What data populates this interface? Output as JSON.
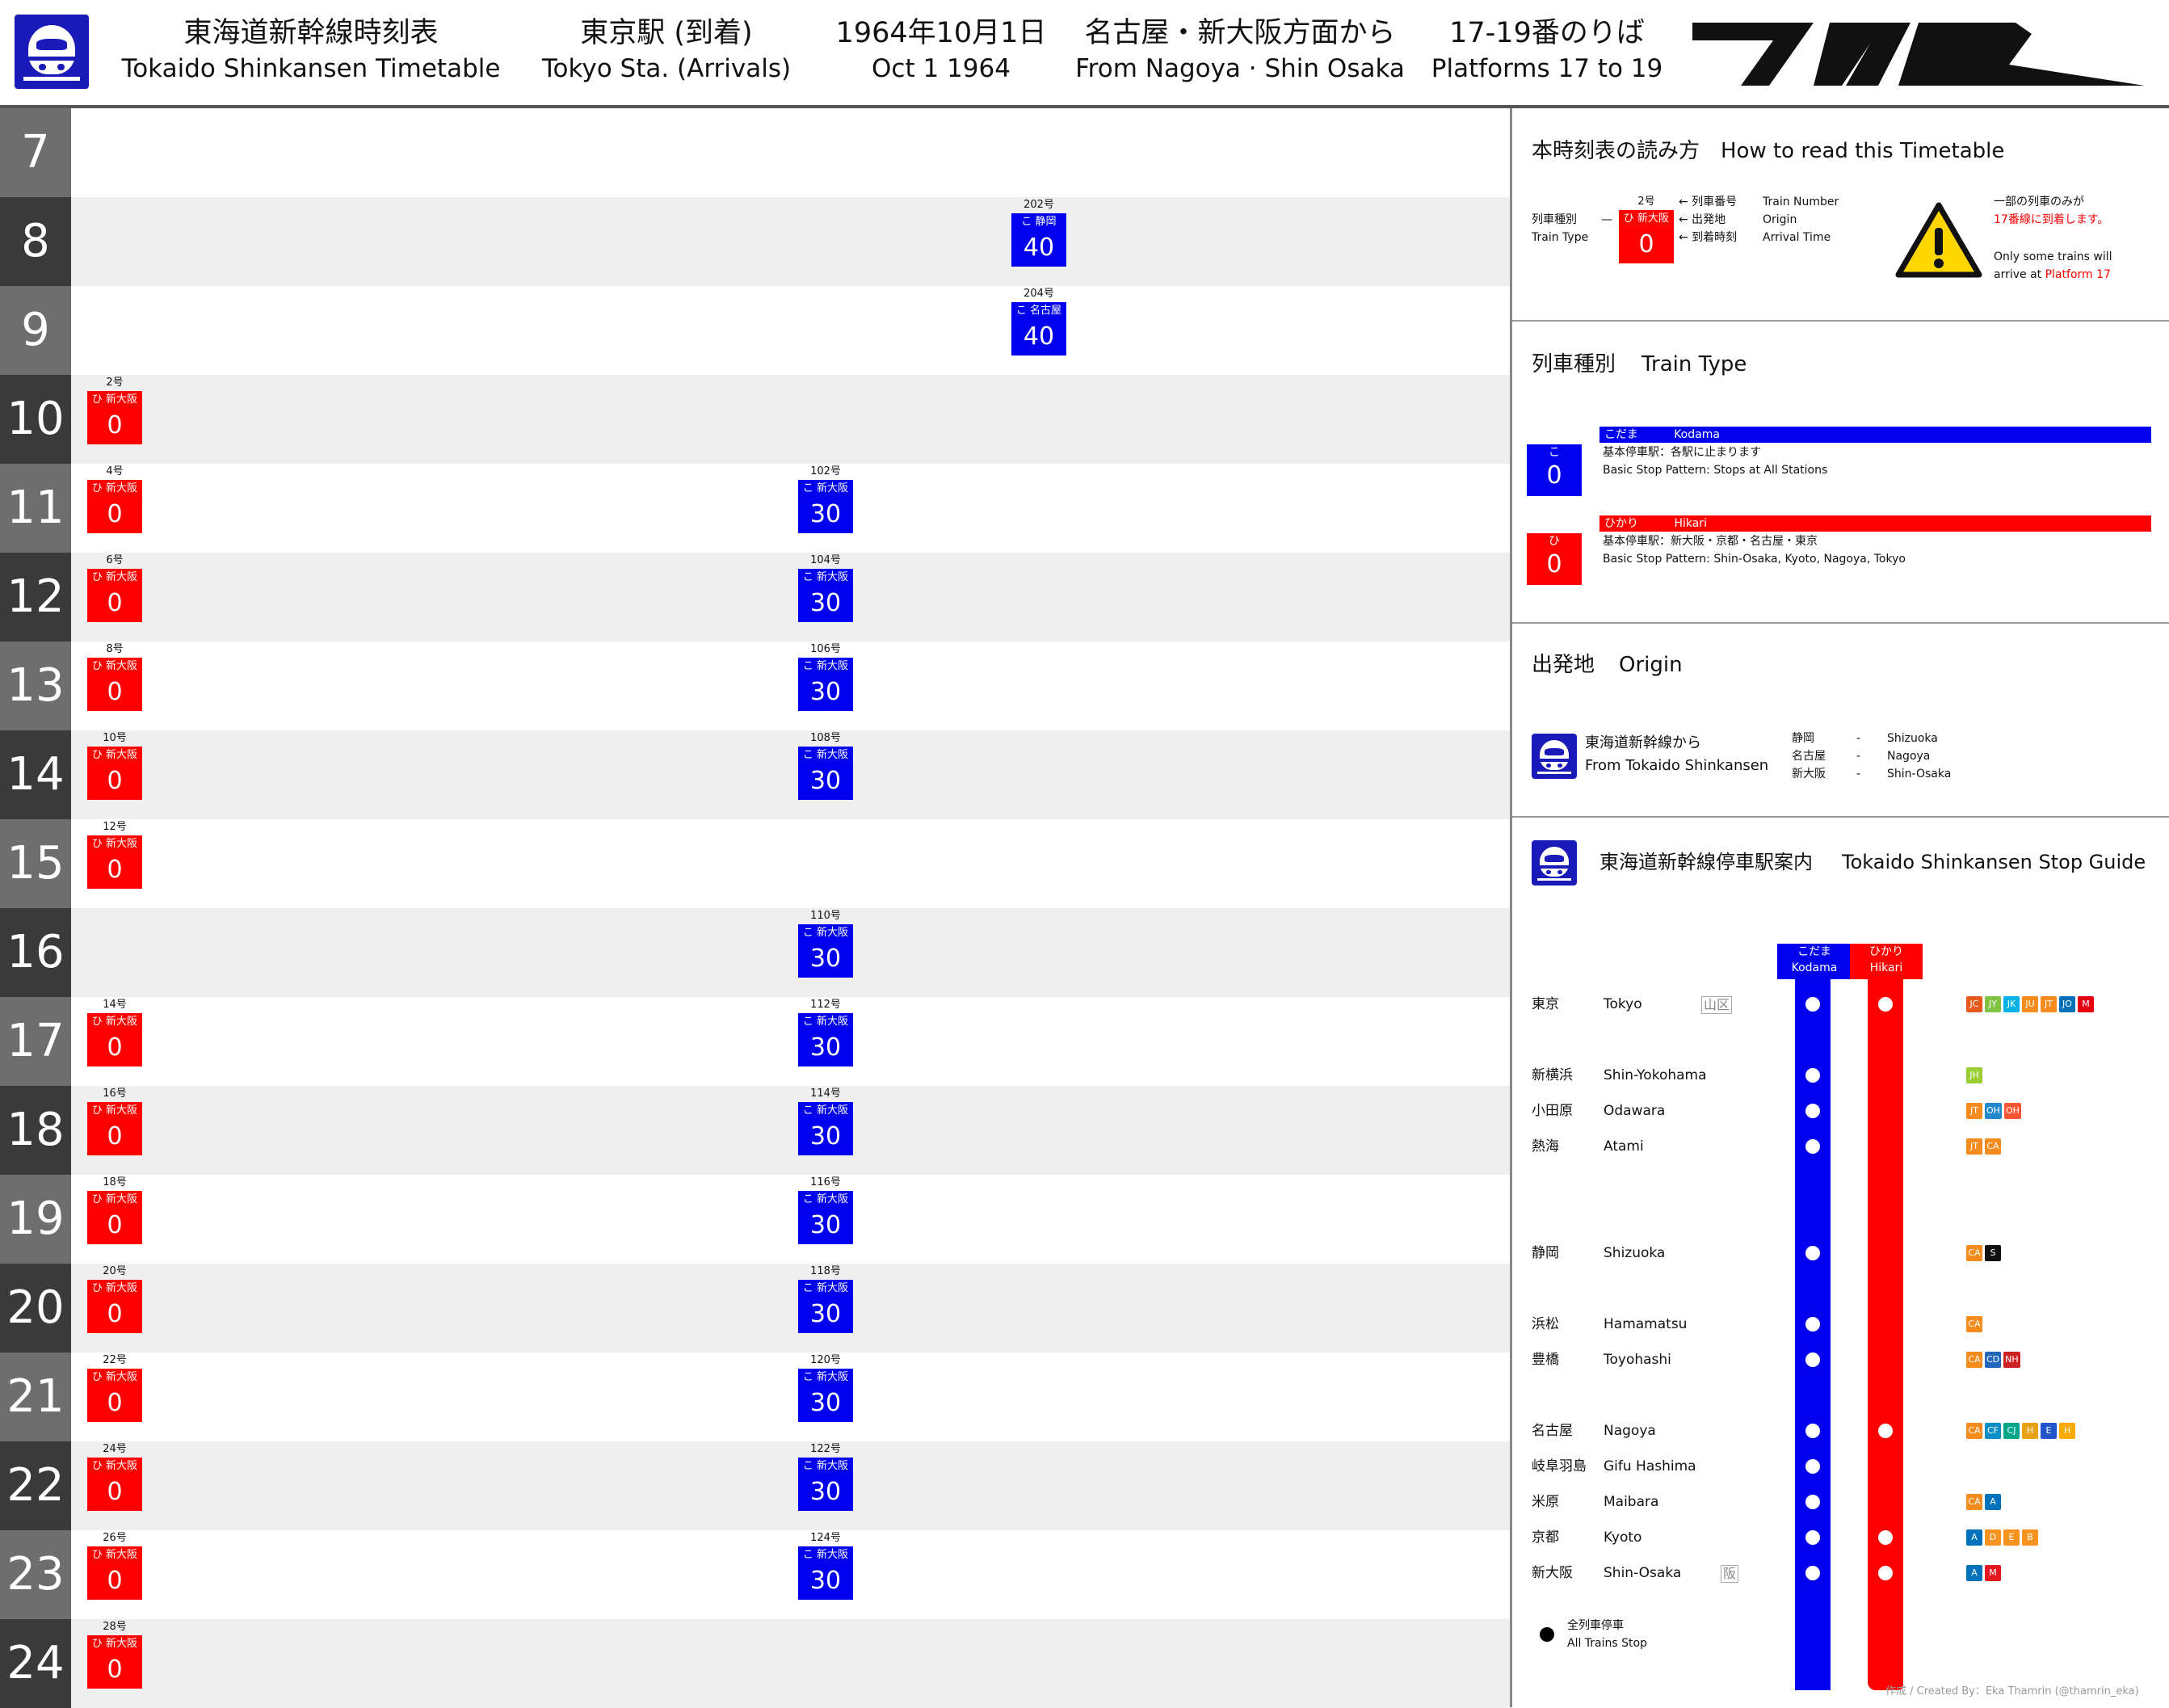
{
  "header": {
    "title_jp": "東海道新幹線時刻表",
    "title_en": "Tokaido Shinkansen Timetable",
    "station_jp": "東京駅 (到着)",
    "station_en": "Tokyo Sta. (Arrivals)",
    "date_jp": "1964年10月1日",
    "date_en": "Oct 1 1964",
    "direction_jp": "名古屋・新大阪方面から",
    "direction_en": "From Nagoya · Shin Osaka",
    "platform_jp": "17-19番のりば",
    "platform_en": "Platforms 17 to 19",
    "brand_logo": "JNR"
  },
  "colors": {
    "hikari": "#ff0000",
    "kodama": "#0000ee",
    "shinkansen_blue": "#1a1ab8"
  },
  "timetable": [
    {
      "hour": "7",
      "trains": []
    },
    {
      "hour": "8",
      "trains": [
        {
          "type": "kodama",
          "number": "202号",
          "tag": "こ 静岡",
          "minute": "40",
          "col": 3
        }
      ]
    },
    {
      "hour": "9",
      "trains": [
        {
          "type": "kodama",
          "number": "204号",
          "tag": "こ 名古屋",
          "minute": "40",
          "col": 3
        }
      ]
    },
    {
      "hour": "10",
      "trains": [
        {
          "type": "hikari",
          "number": "2号",
          "tag": "ひ 新大阪",
          "minute": "0",
          "col": 0
        }
      ]
    },
    {
      "hour": "11",
      "trains": [
        {
          "type": "hikari",
          "number": "4号",
          "tag": "ひ 新大阪",
          "minute": "0",
          "col": 0
        },
        {
          "type": "kodama",
          "number": "102号",
          "tag": "こ 新大阪",
          "minute": "30",
          "col": 2
        }
      ]
    },
    {
      "hour": "12",
      "trains": [
        {
          "type": "hikari",
          "number": "6号",
          "tag": "ひ 新大阪",
          "minute": "0",
          "col": 0
        },
        {
          "type": "kodama",
          "number": "104号",
          "tag": "こ 新大阪",
          "minute": "30",
          "col": 2
        }
      ]
    },
    {
      "hour": "13",
      "trains": [
        {
          "type": "hikari",
          "number": "8号",
          "tag": "ひ 新大阪",
          "minute": "0",
          "col": 0
        },
        {
          "type": "kodama",
          "number": "106号",
          "tag": "こ 新大阪",
          "minute": "30",
          "col": 2
        }
      ]
    },
    {
      "hour": "14",
      "trains": [
        {
          "type": "hikari",
          "number": "10号",
          "tag": "ひ 新大阪",
          "minute": "0",
          "col": 0
        },
        {
          "type": "kodama",
          "number": "108号",
          "tag": "こ 新大阪",
          "minute": "30",
          "col": 2
        }
      ]
    },
    {
      "hour": "15",
      "trains": [
        {
          "type": "hikari",
          "number": "12号",
          "tag": "ひ 新大阪",
          "minute": "0",
          "col": 0
        }
      ]
    },
    {
      "hour": "16",
      "trains": [
        {
          "type": "kodama",
          "number": "110号",
          "tag": "こ 新大阪",
          "minute": "30",
          "col": 2
        }
      ]
    },
    {
      "hour": "17",
      "trains": [
        {
          "type": "hikari",
          "number": "14号",
          "tag": "ひ 新大阪",
          "minute": "0",
          "col": 0
        },
        {
          "type": "kodama",
          "number": "112号",
          "tag": "こ 新大阪",
          "minute": "30",
          "col": 2
        }
      ]
    },
    {
      "hour": "18",
      "trains": [
        {
          "type": "hikari",
          "number": "16号",
          "tag": "ひ 新大阪",
          "minute": "0",
          "col": 0
        },
        {
          "type": "kodama",
          "number": "114号",
          "tag": "こ 新大阪",
          "minute": "30",
          "col": 2
        }
      ]
    },
    {
      "hour": "19",
      "trains": [
        {
          "type": "hikari",
          "number": "18号",
          "tag": "ひ 新大阪",
          "minute": "0",
          "col": 0
        },
        {
          "type": "kodama",
          "number": "116号",
          "tag": "こ 新大阪",
          "minute": "30",
          "col": 2
        }
      ]
    },
    {
      "hour": "20",
      "trains": [
        {
          "type": "hikari",
          "number": "20号",
          "tag": "ひ 新大阪",
          "minute": "0",
          "col": 0
        },
        {
          "type": "kodama",
          "number": "118号",
          "tag": "こ 新大阪",
          "minute": "30",
          "col": 2
        }
      ]
    },
    {
      "hour": "21",
      "trains": [
        {
          "type": "hikari",
          "number": "22号",
          "tag": "ひ 新大阪",
          "minute": "0",
          "col": 0
        },
        {
          "type": "kodama",
          "number": "120号",
          "tag": "こ 新大阪",
          "minute": "30",
          "col": 2
        }
      ]
    },
    {
      "hour": "22",
      "trains": [
        {
          "type": "hikari",
          "number": "24号",
          "tag": "ひ 新大阪",
          "minute": "0",
          "col": 0
        },
        {
          "type": "kodama",
          "number": "122号",
          "tag": "こ 新大阪",
          "minute": "30",
          "col": 2
        }
      ]
    },
    {
      "hour": "23",
      "trains": [
        {
          "type": "hikari",
          "number": "26号",
          "tag": "ひ 新大阪",
          "minute": "0",
          "col": 0
        },
        {
          "type": "kodama",
          "number": "124号",
          "tag": "こ 新大阪",
          "minute": "30",
          "col": 2
        }
      ]
    },
    {
      "hour": "24",
      "trains": [
        {
          "type": "hikari",
          "number": "28号",
          "tag": "ひ 新大阪",
          "minute": "0",
          "col": 0
        }
      ]
    }
  ],
  "howto": {
    "title_jp": "本時刻表の読み方",
    "title_en": "How to read this Timetable",
    "type_jp": "列車種別",
    "type_en": "Train Type",
    "sample_number": "2号",
    "sample_tag": "ひ 新大阪",
    "sample_minute": "0",
    "label_number_jp": "← 列車番号",
    "label_origin_jp": "← 出発地",
    "label_time_jp": "← 到着時刻",
    "label_number_en": "Train Number",
    "label_origin_en": "Origin",
    "label_time_en": "Arrival Time",
    "warning_icon": "warning-triangle-icon",
    "note_jp_1": "一部の列車のみが",
    "note_jp_2": "17番線に到着します。",
    "note_en_1": "Only some trains will",
    "note_en_2": "arrive at ",
    "note_en_platform": "Platform 17"
  },
  "train_types": {
    "title_jp": "列車種別",
    "title_en": "Train Type",
    "kodama": {
      "icon": "こ",
      "minute": "0",
      "name_jp": "こだま",
      "name_en": "Kodama",
      "desc_jp": "基本停車駅：各駅に止まります",
      "desc_en": "Basic Stop Pattern: Stops at All Stations"
    },
    "hikari": {
      "icon": "ひ",
      "minute": "0",
      "name_jp": "ひかり",
      "name_en": "Hikari",
      "desc_jp": "基本停車駅：新大阪・京都・名古屋・東京",
      "desc_en": "Basic Stop Pattern: Shin-Osaka, Kyoto, Nagoya, Tokyo"
    }
  },
  "origin": {
    "title_jp": "出発地",
    "title_en": "Origin",
    "from_jp": "東海道新幹線から",
    "from_en": "From Tokaido Shinkansen",
    "list": [
      {
        "jp": "静岡",
        "dash": "-",
        "en": "Shizuoka"
      },
      {
        "jp": "名古屋",
        "dash": "-",
        "en": "Nagoya"
      },
      {
        "jp": "新大阪",
        "dash": "-",
        "en": "Shin-Osaka"
      }
    ]
  },
  "stop_guide": {
    "title_jp": "東海道新幹線停車駅案内",
    "title_en": "Tokaido Shinkansen Stop Guide",
    "kodama_jp": "こだま",
    "kodama_en": "Kodama",
    "hikari_jp": "ひかり",
    "hikari_en": "Hikari",
    "stations": [
      {
        "jp": "東京",
        "en": "Tokyo",
        "mark": "山区",
        "kodama": true,
        "hikari": true,
        "conn": [
          "JC",
          "JY",
          "JK",
          "JU",
          "JT",
          "JO",
          "M"
        ],
        "conn_colors": [
          "#e65a1e",
          "#80c241",
          "#00b2e5",
          "#f68b1e",
          "#f68b1e",
          "#0070b9",
          "#e60012"
        ]
      },
      {
        "jp": "新横浜",
        "en": "Shin-Yokohama",
        "mark": "",
        "kodama": true,
        "hikari": false,
        "conn": [
          "JH"
        ],
        "conn_colors": [
          "#9acd32"
        ]
      },
      {
        "jp": "小田原",
        "en": "Odawara",
        "mark": "",
        "kodama": true,
        "hikari": false,
        "conn": [
          "JT",
          "OH",
          "OH"
        ],
        "conn_colors": [
          "#f68b1e",
          "#2288cc",
          "#ff5533"
        ]
      },
      {
        "jp": "熱海",
        "en": "Atami",
        "mark": "",
        "kodama": true,
        "hikari": false,
        "conn": [
          "JT",
          "CA"
        ],
        "conn_colors": [
          "#f68b1e",
          "#f68b1e"
        ]
      },
      {
        "jp": "静岡",
        "en": "Shizuoka",
        "mark": "",
        "kodama": true,
        "hikari": false,
        "conn": [
          "CA",
          "S"
        ],
        "conn_colors": [
          "#f68b1e",
          "#111111"
        ]
      },
      {
        "jp": "浜松",
        "en": "Hamamatsu",
        "mark": "",
        "kodama": true,
        "hikari": false,
        "conn": [
          "CA"
        ],
        "conn_colors": [
          "#f68b1e"
        ]
      },
      {
        "jp": "豊橋",
        "en": "Toyohashi",
        "mark": "",
        "kodama": true,
        "hikari": false,
        "conn": [
          "CA",
          "CD",
          "NH"
        ],
        "conn_colors": [
          "#f68b1e",
          "#2266bb",
          "#cc2222"
        ]
      },
      {
        "jp": "名古屋",
        "en": "Nagoya",
        "mark": "",
        "kodama": true,
        "hikari": true,
        "conn": [
          "CA",
          "CF",
          "CJ",
          "H",
          "E",
          "H"
        ],
        "conn_colors": [
          "#f68b1e",
          "#0a8ec6",
          "#00a58a",
          "#e8a215",
          "#2255cc",
          "#ffaa00"
        ]
      },
      {
        "jp": "岐阜羽島",
        "en": "Gifu Hashima",
        "mark": "",
        "kodama": true,
        "hikari": false,
        "conn": [],
        "conn_colors": []
      },
      {
        "jp": "米原",
        "en": "Maibara",
        "mark": "",
        "kodama": true,
        "hikari": false,
        "conn": [
          "CA",
          "A"
        ],
        "conn_colors": [
          "#f68b1e",
          "#0072bc"
        ]
      },
      {
        "jp": "京都",
        "en": "Kyoto",
        "mark": "",
        "kodama": true,
        "hikari": true,
        "conn": [
          "A",
          "D",
          "E",
          "B"
        ],
        "conn_colors": [
          "#0072bc",
          "#f7931e",
          "#f7931e",
          "#f7931e"
        ]
      },
      {
        "jp": "新大阪",
        "en": "Shin-Osaka",
        "mark": "阪",
        "kodama": true,
        "hikari": true,
        "conn": [
          "A",
          "M"
        ],
        "conn_colors": [
          "#0072bc",
          "#e5171f"
        ]
      }
    ],
    "legend_jp": "全列車停車",
    "legend_en": "All Trains Stop"
  },
  "credit": "作成 / Created By：Eka Thamrin (@thamrin_eka)"
}
